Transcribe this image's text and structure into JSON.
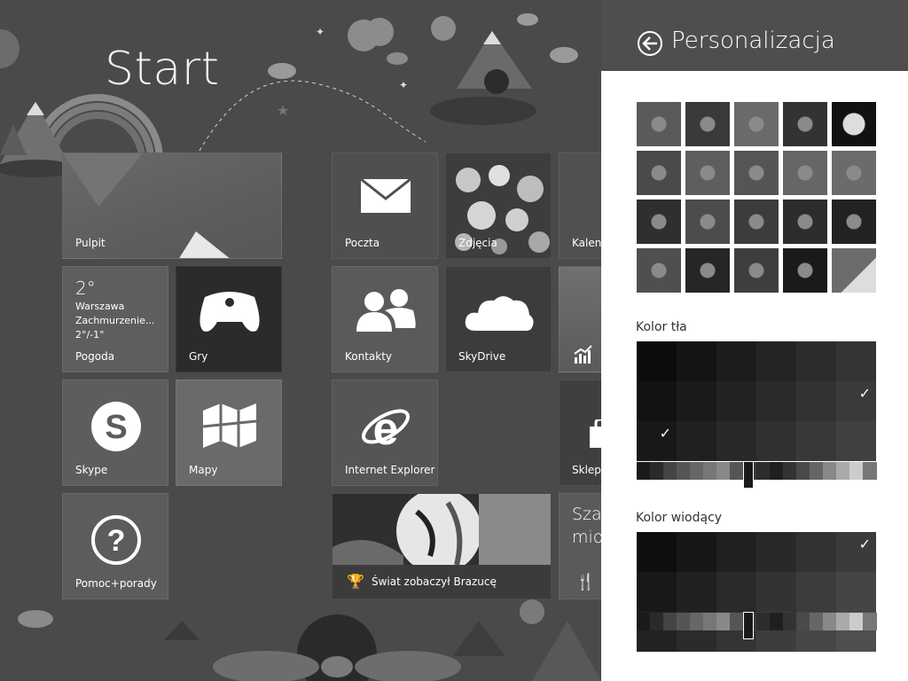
{
  "start": {
    "title": "Start",
    "tiles": {
      "pulpit": "Pulpit",
      "poczta": "Poczta",
      "zdjecia": "Zdjęcia",
      "kalendarz": "Kalend",
      "pogoda": {
        "label": "Pogoda",
        "temp": "2°",
        "city": "Warszawa",
        "condition": "Zachmurzenie...",
        "range": "2°/-1°"
      },
      "gry": "Gry",
      "kontakty": "Kontakty",
      "skydrive": "SkyDrive",
      "skype": "Skype",
      "mapy": "Mapy",
      "ie": "Internet Explorer",
      "sklep": "Sklep",
      "pomoc": "Pomoc+porady",
      "sport": "Świat zobaczył Brazucę",
      "szam": [
        "Sza",
        "mio"
      ]
    }
  },
  "panel": {
    "title": "Personalizacja",
    "background_label": "Kolor tła",
    "accent_label": "Kolor wiodący",
    "thumbnails_count": 20,
    "selected_background_index": 13,
    "selected_accent_index": 6
  },
  "colors": {
    "header_bg": "#4e4e4e",
    "panel_bg": "#ffffff",
    "start_bg": "#4a4a4a"
  }
}
